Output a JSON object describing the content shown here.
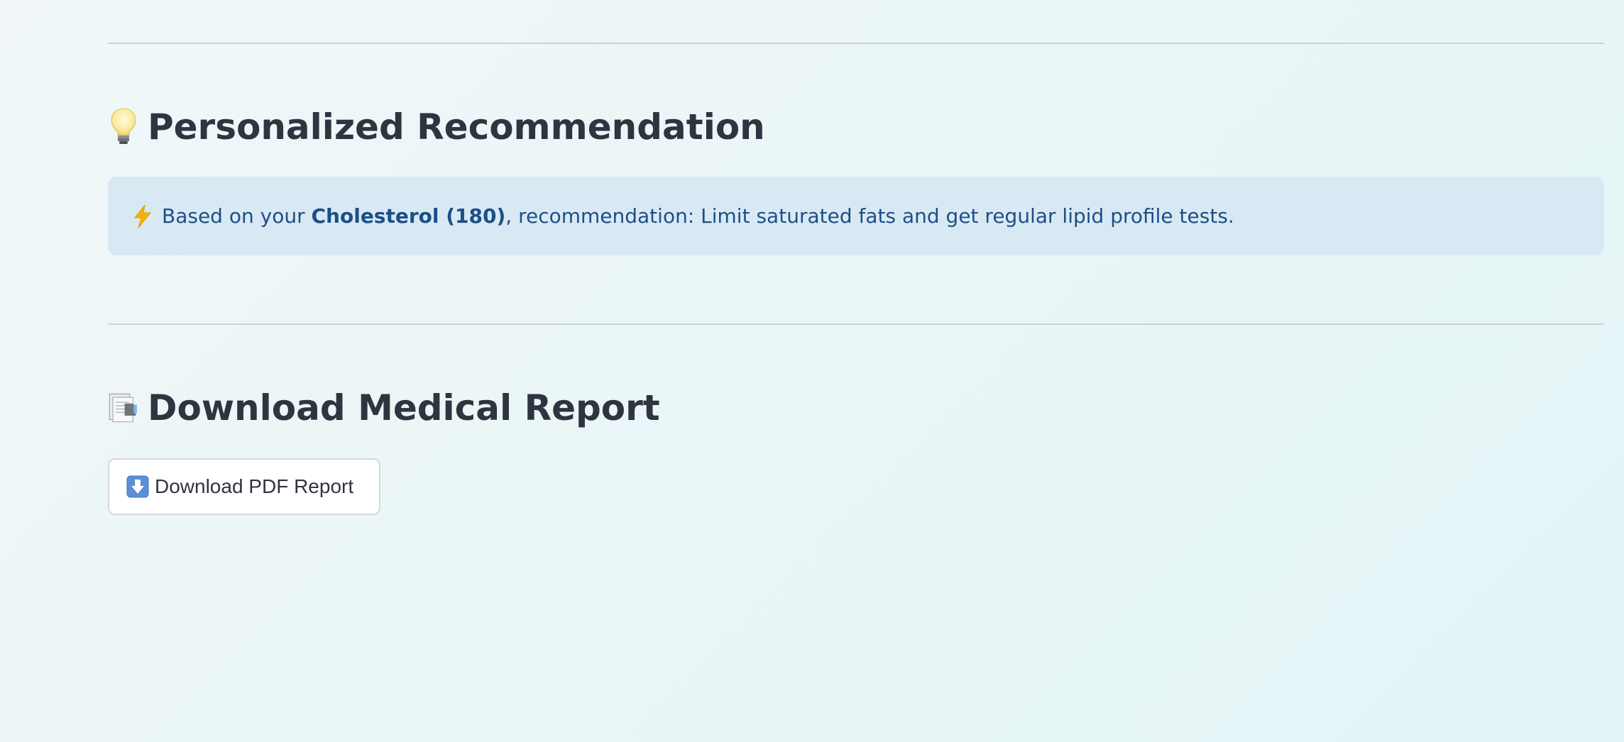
{
  "recommendation": {
    "title": "Personalized Recommendation",
    "title_icon": "lightbulb-icon",
    "alert_icon": "lightning-icon",
    "alert_prefix": "Based on your ",
    "alert_highlight": "Cholesterol (180)",
    "alert_suffix": ", recommendation: Limit saturated fats and get regular lipid profile tests."
  },
  "download": {
    "title": "Download Medical Report",
    "title_icon": "document-icon",
    "button_label": "Download PDF Report",
    "button_icon": "down-arrow-icon"
  },
  "colors": {
    "alert_background": "#d9e9f4",
    "alert_text": "#1d4f86",
    "heading_text": "#2f3440"
  }
}
